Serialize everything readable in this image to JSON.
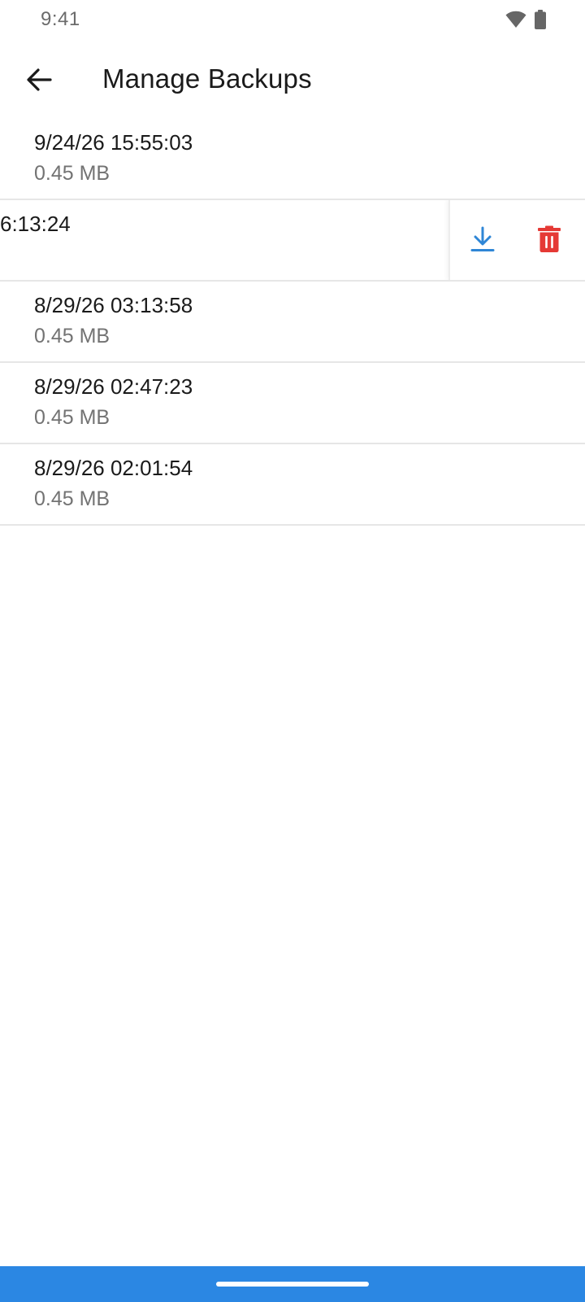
{
  "status_bar": {
    "time": "9:41",
    "icons": [
      "wifi-icon",
      "battery-icon"
    ],
    "icon_color": "#666666"
  },
  "app_bar": {
    "back_icon": "arrow-back-icon",
    "title": "Manage Backups"
  },
  "backups": [
    {
      "date": "9/24/26 15:55:03",
      "size": "0.45 MB",
      "swiped": false
    },
    {
      "date": "6:13:24",
      "size": "",
      "swiped": true
    },
    {
      "date": "8/29/26 03:13:58",
      "size": "0.45 MB",
      "swiped": false
    },
    {
      "date": "8/29/26 02:47:23",
      "size": "0.45 MB",
      "swiped": false
    },
    {
      "date": "8/29/26 02:01:54",
      "size": "0.45 MB",
      "swiped": false
    }
  ],
  "row_actions": {
    "download_icon": "download-icon",
    "delete_icon": "trash-icon",
    "download_color": "#2f86d6",
    "delete_color": "#e53935"
  },
  "nav_bar": {
    "color": "#2b87e3"
  }
}
